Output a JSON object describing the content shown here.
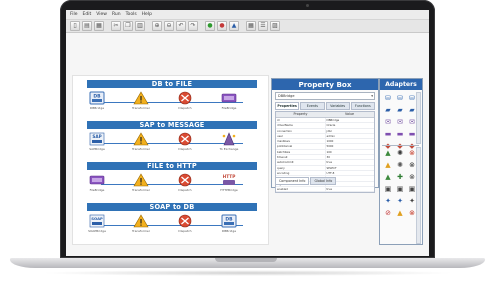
{
  "menubar": {
    "items": [
      {
        "label": "File"
      },
      {
        "label": "Edit"
      },
      {
        "label": "View"
      },
      {
        "label": "Run"
      },
      {
        "label": "Tools"
      },
      {
        "label": "Help"
      }
    ]
  },
  "toolbar": {
    "buttons": [
      {
        "icon": "new-icon",
        "glyph": "▯"
      },
      {
        "icon": "open-icon",
        "glyph": "▤"
      },
      {
        "icon": "save-icon",
        "glyph": "▦"
      },
      {
        "icon": "cut-icon",
        "glyph": "✂"
      },
      {
        "icon": "copy-icon",
        "glyph": "❐"
      },
      {
        "icon": "paste-icon",
        "glyph": "▥"
      },
      {
        "icon": "zoom-in-icon",
        "glyph": "⊕"
      },
      {
        "icon": "zoom-out-icon",
        "glyph": "⊖"
      },
      {
        "icon": "undo-icon",
        "glyph": "↶"
      },
      {
        "icon": "redo-icon",
        "glyph": "↷"
      },
      {
        "icon": "run-icon",
        "glyph": "●",
        "tone": "green"
      },
      {
        "icon": "stop-icon",
        "glyph": "●",
        "tone": "red"
      },
      {
        "icon": "deploy-icon",
        "glyph": "▲",
        "tone": "blue"
      },
      {
        "icon": "grid-icon",
        "glyph": "▦"
      },
      {
        "icon": "properties-icon",
        "glyph": "☰"
      },
      {
        "icon": "layout-icon",
        "glyph": "▨"
      }
    ]
  },
  "flows": [
    {
      "title": "DB to FILE",
      "nodes": [
        {
          "type": "db",
          "label": "DBBridge"
        },
        {
          "type": "warning",
          "label": "Transformer"
        },
        {
          "type": "router",
          "label": "Dispatch"
        },
        {
          "type": "file",
          "label": "FileBridge"
        }
      ]
    },
    {
      "title": "SAP to MESSAGE",
      "nodes": [
        {
          "type": "sap",
          "label": "SAPBridge"
        },
        {
          "type": "warning",
          "label": "Transformer"
        },
        {
          "type": "router",
          "label": "Dispatch"
        },
        {
          "type": "message",
          "label": "To Exchange"
        }
      ]
    },
    {
      "title": "FILE to HTTP",
      "nodes": [
        {
          "type": "file",
          "label": "FileBridge"
        },
        {
          "type": "warning",
          "label": "Transformer"
        },
        {
          "type": "router",
          "label": "Dispatch"
        },
        {
          "type": "http",
          "label": "HTTPBridge"
        }
      ]
    },
    {
      "title": "SOAP to DB",
      "nodes": [
        {
          "type": "soap",
          "label": "SOAPBridge"
        },
        {
          "type": "warning",
          "label": "Transformer"
        },
        {
          "type": "router",
          "label": "Dispatch"
        },
        {
          "type": "db",
          "label": "DBBridge"
        }
      ]
    }
  ],
  "property_box": {
    "title": "Property Box",
    "selected": "DBBridge",
    "tabs": [
      "Properties",
      "Events",
      "Variables",
      "Functions"
    ],
    "table_headers": [
      "Property",
      "Value"
    ],
    "rows": [
      {
        "name": "id",
        "value": "DBBridge"
      },
      {
        "name": "driverName",
        "value": "Oracle"
      },
      {
        "name": "connection",
        "value": "jdbc"
      },
      {
        "name": "user",
        "value": "admin"
      },
      {
        "name": "maxRows",
        "value": "1000"
      },
      {
        "name": "pollInterval",
        "value": "5000"
      },
      {
        "name": "batchSize",
        "value": "100"
      },
      {
        "name": "timeout",
        "value": "30"
      },
      {
        "name": "autoCommit",
        "value": "true"
      },
      {
        "name": "query",
        "value": "SELECT"
      },
      {
        "name": "encoding",
        "value": "UTF-8"
      },
      {
        "name": "retryCount",
        "value": "3"
      },
      {
        "name": "logLevel",
        "value": "INFO"
      },
      {
        "name": "enabled",
        "value": "true"
      }
    ],
    "bottom_tabs": [
      "Component Info",
      "Global Info"
    ]
  },
  "adapters": {
    "title": "Adapters",
    "group1": [
      {
        "icon": "db-adapter-icon",
        "glyph": "⛁",
        "color": "#3a6fb5"
      },
      {
        "icon": "db-adapter-icon",
        "glyph": "⛁",
        "color": "#3a6fb5"
      },
      {
        "icon": "db-adapter-icon",
        "glyph": "⛁",
        "color": "#3a6fb5"
      },
      {
        "icon": "sap-adapter-icon",
        "glyph": "▰",
        "color": "#2c5fa8"
      },
      {
        "icon": "sap-adapter-icon",
        "glyph": "▰",
        "color": "#2c5fa8"
      },
      {
        "icon": "sap-adapter-icon",
        "glyph": "▰",
        "color": "#2c5fa8"
      },
      {
        "icon": "message-adapter-icon",
        "glyph": "✉",
        "color": "#7a58a6"
      },
      {
        "icon": "message-adapter-icon",
        "glyph": "✉",
        "color": "#7a58a6"
      },
      {
        "icon": "message-adapter-icon",
        "glyph": "✉",
        "color": "#7a58a6"
      },
      {
        "icon": "file-adapter-icon",
        "glyph": "▬",
        "color": "#7f4fb0"
      },
      {
        "icon": "file-adapter-icon",
        "glyph": "▬",
        "color": "#7f4fb0"
      },
      {
        "icon": "file-adapter-icon",
        "glyph": "▬",
        "color": "#7f4fb0"
      },
      {
        "icon": "http-adapter-icon",
        "glyph": "◆",
        "color": "#c34a3a"
      },
      {
        "icon": "http-adapter-icon",
        "glyph": "◆",
        "color": "#c34a3a"
      },
      {
        "icon": "http-adapter-icon",
        "glyph": "◆",
        "color": "#c34a3a"
      }
    ],
    "group2": [
      {
        "icon": "transform-icon",
        "glyph": "▲",
        "color": "#3d8a3d"
      },
      {
        "icon": "gear-icon",
        "glyph": "✺",
        "color": "#333333"
      },
      {
        "icon": "router-icon",
        "glyph": "⊗",
        "color": "#c6402f"
      },
      {
        "icon": "transform-icon",
        "glyph": "▲",
        "color": "#e0a020"
      },
      {
        "icon": "gear-icon",
        "glyph": "✺",
        "color": "#555555"
      },
      {
        "icon": "router-icon",
        "glyph": "⊗",
        "color": "#333333"
      },
      {
        "icon": "transform-icon",
        "glyph": "▲",
        "color": "#3d8a3d"
      },
      {
        "icon": "filter-icon",
        "glyph": "✚",
        "color": "#2e7d32"
      },
      {
        "icon": "router-icon",
        "glyph": "⊗",
        "color": "#444444"
      },
      {
        "icon": "queue-icon",
        "glyph": "▣",
        "color": "#444444"
      },
      {
        "icon": "queue-icon",
        "glyph": "▣",
        "color": "#444444"
      },
      {
        "icon": "queue-icon",
        "glyph": "▣",
        "color": "#444444"
      },
      {
        "icon": "split-icon",
        "glyph": "✦",
        "color": "#2a5da8"
      },
      {
        "icon": "split-icon",
        "glyph": "✦",
        "color": "#2a5da8"
      },
      {
        "icon": "split-icon",
        "glyph": "✦",
        "color": "#444444"
      },
      {
        "icon": "stop-icon",
        "glyph": "⊘",
        "color": "#c43a3a"
      },
      {
        "icon": "warning-icon",
        "glyph": "▲",
        "color": "#e0a020"
      },
      {
        "icon": "router-icon",
        "glyph": "⊗",
        "color": "#c6402f"
      }
    ]
  },
  "colors": {
    "title_bar": "#2f72b6",
    "flow_line": "#3b78c0",
    "warning": "#f2b01e",
    "router": "#d94a32"
  }
}
